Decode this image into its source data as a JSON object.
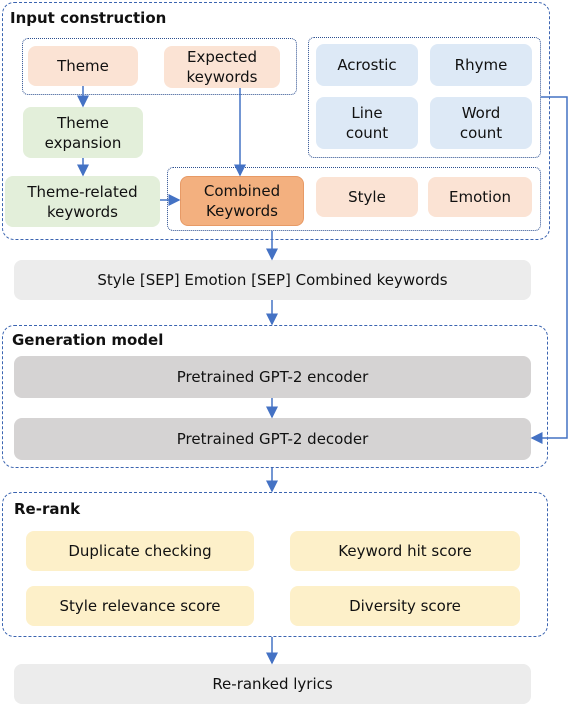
{
  "input_construction": {
    "title": "Input construction",
    "theme": "Theme",
    "expected_keywords": "Expected keywords",
    "acrostic": "Acrostic",
    "rhyme": "Rhyme",
    "line_count": "Line count",
    "word_count": "Word count",
    "theme_expansion": "Theme expansion",
    "theme_related_keywords": "Theme-related keywords",
    "combined_keywords": "Combined Keywords",
    "style": "Style",
    "emotion": "Emotion"
  },
  "sequence": "Style [SEP] Emotion [SEP] Combined keywords",
  "generation_model": {
    "title": "Generation model",
    "encoder": "Pretrained GPT-2 encoder",
    "decoder": "Pretrained GPT-2 decoder"
  },
  "rerank": {
    "title": "Re-rank",
    "duplicate": "Duplicate checking",
    "keyword_hit": "Keyword hit score",
    "style_relevance": "Style relevance score",
    "diversity": "Diversity score"
  },
  "output": "Re-ranked lyrics",
  "colors": {
    "arrow": "#4472c4",
    "border": "#3b64b0",
    "peach": "#fbe3d4",
    "blue": "#dde9f6",
    "green": "#e3efda",
    "orange": "#f3b07f",
    "yellow": "#fdf0c9"
  }
}
